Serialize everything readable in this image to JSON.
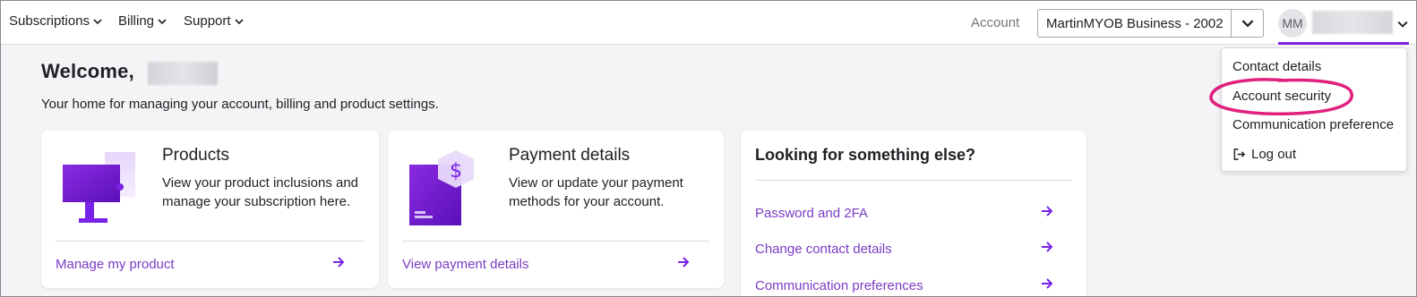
{
  "nav": {
    "subscriptions": "Subscriptions",
    "billing": "Billing",
    "support": "Support",
    "account_label": "Account",
    "account_value": "MartinMYOB Business - 2002",
    "avatar_initials": "MM"
  },
  "dropdown": {
    "contact_details": "Contact details",
    "account_security": "Account security",
    "communication_preference": "Communication preference",
    "log_out": "Log out"
  },
  "main": {
    "welcome": "Welcome,",
    "subtitle": "Your home for managing your account, billing and product settings."
  },
  "cards": {
    "products": {
      "title": "Products",
      "desc": "View your product inclusions and manage your subscription here.",
      "link": "Manage my product"
    },
    "payment": {
      "title": "Payment details",
      "desc": "View or update your payment methods for your account.",
      "link": "View payment details"
    },
    "else": {
      "title": "Looking for something else?",
      "links": [
        "Password and 2FA",
        "Change contact details",
        "Communication preferences"
      ]
    }
  },
  "colors": {
    "accent": "#7a22e8",
    "link": "#7a3cc4",
    "highlight_ring": "#e0207e"
  }
}
